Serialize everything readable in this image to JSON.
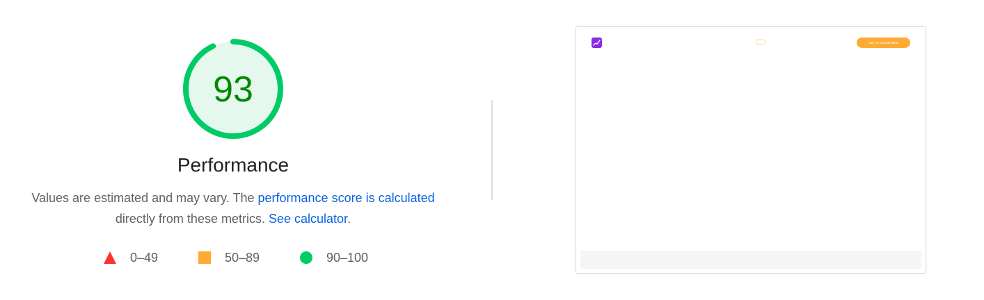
{
  "gauge": {
    "score": "93",
    "fraction": 0.93,
    "ring_color": "#00cc66",
    "fill_color": "#e5f8ee",
    "text_color": "#008800"
  },
  "category": {
    "title": "Performance"
  },
  "description": {
    "prefix": "Values are estimated and may vary. The ",
    "link1": "performance score is calculated",
    "middle": "directly from these metrics.",
    "link2": "See calculator",
    "suffix": "."
  },
  "legend": {
    "fail": {
      "label": "0–49",
      "icon": "red-triangle-icon",
      "color": "#ff3333"
    },
    "average": {
      "label": "50–89",
      "icon": "orange-square-icon",
      "color": "#ffaa33"
    },
    "pass": {
      "label": "90–100",
      "icon": "green-circle-icon",
      "color": "#00cc66"
    }
  },
  "screenshot": {
    "button_label": "GET IN TOUCH NOW",
    "logo_color": "#8a2be2",
    "button_color": "#ffaa33"
  }
}
